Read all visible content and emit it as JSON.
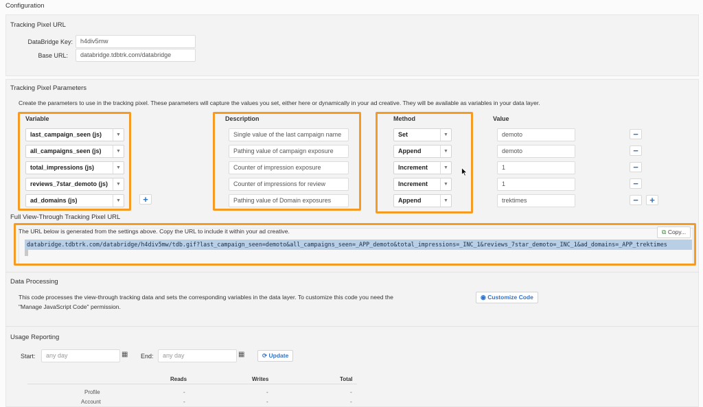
{
  "page": {
    "title": "Configuration"
  },
  "tracking_pixel_url": {
    "heading": "Tracking Pixel URL",
    "key_label": "DataBridge Key:",
    "key_value": "h4div5mw",
    "base_label": "Base URL:",
    "base_value": "databridge.tdbtrk.com/databridge"
  },
  "params": {
    "heading": "Tracking Pixel Parameters",
    "intro": "Create the parameters to use in the tracking pixel. These parameters will capture the values you set, either here or dynamically in your ad creative. They will be available as variables in your data layer.",
    "col_variable": "Variable",
    "col_description": "Description",
    "col_method": "Method",
    "col_value": "Value",
    "rows": [
      {
        "variable": "last_campaign_seen (js)",
        "description": "Single value of the last campaign name",
        "method": "Set",
        "value": "demoto"
      },
      {
        "variable": "all_campaigns_seen (js)",
        "description": "Pathing value of campaign exposure",
        "method": "Append",
        "value": "demoto"
      },
      {
        "variable": "total_impressions (js)",
        "description": "Counter of impression exposure",
        "method": "Increment",
        "value": "1"
      },
      {
        "variable": "reviews_7star_demoto (js)",
        "description": "Counter of impressions for review",
        "method": "Increment",
        "value": "1"
      },
      {
        "variable": "ad_domains (js)",
        "description": "Pathing value of Domain exposures",
        "method": "Append",
        "value": "trektimes"
      }
    ],
    "remove_symbol": "−",
    "add_symbol": "+"
  },
  "full_url": {
    "heading": "Full View-Through Tracking Pixel URL",
    "note": "The URL below is generated from the settings above. Copy the URL to include it within your ad creative.",
    "copy_label": "Copy...",
    "url": "databridge.tdbtrk.com/databridge/h4div5mw/tdb.gif?last_campaign_seen=demoto&all_campaigns_seen=_APP_demoto&total_impressions=_INC_1&reviews_7star_demoto=_INC_1&ad_domains=_APP_trektimes"
  },
  "data_processing": {
    "heading": "Data Processing",
    "text_line1": "This code processes the view-through tracking data and sets the corresponding variables in the data layer. To customize this code you need the",
    "text_line2": "\"Manage JavaScript Code\" permission.",
    "button_label": "Customize Code"
  },
  "usage": {
    "heading": "Usage Reporting",
    "start_label": "Start:",
    "start_placeholder": "any day",
    "end_label": "End:",
    "end_placeholder": "any day",
    "update_label": "Update",
    "columns": [
      "Reads",
      "Writes",
      "Total"
    ],
    "rows": [
      {
        "label": "Profile",
        "reads": "-",
        "writes": "-",
        "total": "-"
      },
      {
        "label": "Account",
        "reads": "-",
        "writes": "-",
        "total": "-"
      }
    ]
  }
}
